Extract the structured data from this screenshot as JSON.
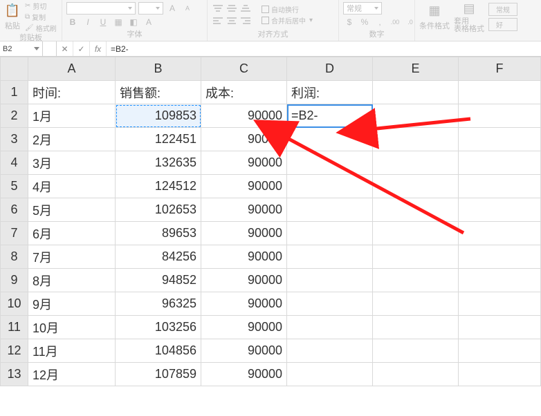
{
  "ribbon": {
    "clipboard": {
      "paste": "粘贴",
      "cut": "剪切",
      "copy": "复制",
      "formatPainter": "格式刷",
      "groupLabel": "剪贴板"
    },
    "font": {
      "fontName": "",
      "fontSize": "",
      "groupLabel": "字体",
      "bold": "B",
      "italic": "I",
      "underline": "U",
      "more": "A"
    },
    "alignment": {
      "wrapText": "自动换行",
      "mergeCenter": "合并后居中",
      "groupLabel": "对齐方式"
    },
    "number": {
      "format": "常规",
      "groupLabel": "数字"
    },
    "styles": {
      "conditional": "条件格式",
      "formatTable": "套用\n表格格式",
      "cellStyles": "常规",
      "good": "好",
      "groupLabel": ""
    }
  },
  "formulaBar": {
    "nameBox": "B2",
    "cancel": "✕",
    "enter": "✓",
    "fxLabel": "fx",
    "formula": "=B2-"
  },
  "columns": [
    "A",
    "B",
    "C",
    "D",
    "E",
    "F"
  ],
  "headers": {
    "time": "时间:",
    "sales": "销售额:",
    "cost": "成本:",
    "profit": "利润:"
  },
  "activeCell": {
    "value": "=B2-"
  },
  "rows": [
    {
      "n": 2,
      "month": "1月",
      "sales": 109853,
      "cost": 90000
    },
    {
      "n": 3,
      "month": "2月",
      "sales": 122451,
      "cost": 90000
    },
    {
      "n": 4,
      "month": "3月",
      "sales": 132635,
      "cost": 90000
    },
    {
      "n": 5,
      "month": "4月",
      "sales": 124512,
      "cost": 90000
    },
    {
      "n": 6,
      "month": "5月",
      "sales": 102653,
      "cost": 90000
    },
    {
      "n": 7,
      "month": "6月",
      "sales": 89653,
      "cost": 90000
    },
    {
      "n": 8,
      "month": "7月",
      "sales": 84256,
      "cost": 90000
    },
    {
      "n": 9,
      "month": "8月",
      "sales": 94852,
      "cost": 90000
    },
    {
      "n": 10,
      "month": "9月",
      "sales": 96325,
      "cost": 90000
    },
    {
      "n": 11,
      "month": "10月",
      "sales": 103256,
      "cost": 90000
    },
    {
      "n": 12,
      "month": "11月",
      "sales": 104856,
      "cost": 90000
    },
    {
      "n": 13,
      "month": "12月",
      "sales": 107859,
      "cost": 90000
    }
  ]
}
